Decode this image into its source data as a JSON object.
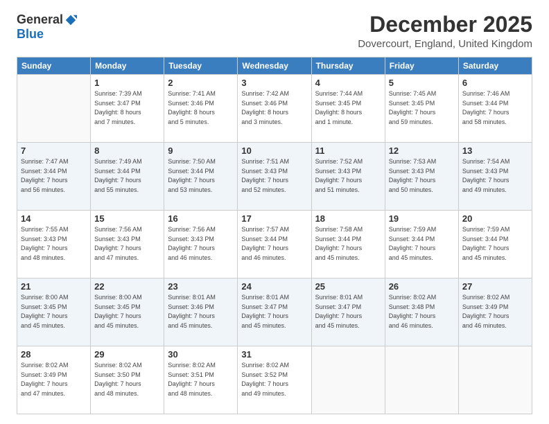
{
  "logo": {
    "general": "General",
    "blue": "Blue"
  },
  "header": {
    "title": "December 2025",
    "subtitle": "Dovercourt, England, United Kingdom"
  },
  "weekdays": [
    "Sunday",
    "Monday",
    "Tuesday",
    "Wednesday",
    "Thursday",
    "Friday",
    "Saturday"
  ],
  "weeks": [
    [
      {
        "day": "",
        "info": ""
      },
      {
        "day": "1",
        "info": "Sunrise: 7:39 AM\nSunset: 3:47 PM\nDaylight: 8 hours\nand 7 minutes."
      },
      {
        "day": "2",
        "info": "Sunrise: 7:41 AM\nSunset: 3:46 PM\nDaylight: 8 hours\nand 5 minutes."
      },
      {
        "day": "3",
        "info": "Sunrise: 7:42 AM\nSunset: 3:46 PM\nDaylight: 8 hours\nand 3 minutes."
      },
      {
        "day": "4",
        "info": "Sunrise: 7:44 AM\nSunset: 3:45 PM\nDaylight: 8 hours\nand 1 minute."
      },
      {
        "day": "5",
        "info": "Sunrise: 7:45 AM\nSunset: 3:45 PM\nDaylight: 7 hours\nand 59 minutes."
      },
      {
        "day": "6",
        "info": "Sunrise: 7:46 AM\nSunset: 3:44 PM\nDaylight: 7 hours\nand 58 minutes."
      }
    ],
    [
      {
        "day": "7",
        "info": "Sunrise: 7:47 AM\nSunset: 3:44 PM\nDaylight: 7 hours\nand 56 minutes."
      },
      {
        "day": "8",
        "info": "Sunrise: 7:49 AM\nSunset: 3:44 PM\nDaylight: 7 hours\nand 55 minutes."
      },
      {
        "day": "9",
        "info": "Sunrise: 7:50 AM\nSunset: 3:44 PM\nDaylight: 7 hours\nand 53 minutes."
      },
      {
        "day": "10",
        "info": "Sunrise: 7:51 AM\nSunset: 3:43 PM\nDaylight: 7 hours\nand 52 minutes."
      },
      {
        "day": "11",
        "info": "Sunrise: 7:52 AM\nSunset: 3:43 PM\nDaylight: 7 hours\nand 51 minutes."
      },
      {
        "day": "12",
        "info": "Sunrise: 7:53 AM\nSunset: 3:43 PM\nDaylight: 7 hours\nand 50 minutes."
      },
      {
        "day": "13",
        "info": "Sunrise: 7:54 AM\nSunset: 3:43 PM\nDaylight: 7 hours\nand 49 minutes."
      }
    ],
    [
      {
        "day": "14",
        "info": "Sunrise: 7:55 AM\nSunset: 3:43 PM\nDaylight: 7 hours\nand 48 minutes."
      },
      {
        "day": "15",
        "info": "Sunrise: 7:56 AM\nSunset: 3:43 PM\nDaylight: 7 hours\nand 47 minutes."
      },
      {
        "day": "16",
        "info": "Sunrise: 7:56 AM\nSunset: 3:43 PM\nDaylight: 7 hours\nand 46 minutes."
      },
      {
        "day": "17",
        "info": "Sunrise: 7:57 AM\nSunset: 3:44 PM\nDaylight: 7 hours\nand 46 minutes."
      },
      {
        "day": "18",
        "info": "Sunrise: 7:58 AM\nSunset: 3:44 PM\nDaylight: 7 hours\nand 45 minutes."
      },
      {
        "day": "19",
        "info": "Sunrise: 7:59 AM\nSunset: 3:44 PM\nDaylight: 7 hours\nand 45 minutes."
      },
      {
        "day": "20",
        "info": "Sunrise: 7:59 AM\nSunset: 3:44 PM\nDaylight: 7 hours\nand 45 minutes."
      }
    ],
    [
      {
        "day": "21",
        "info": "Sunrise: 8:00 AM\nSunset: 3:45 PM\nDaylight: 7 hours\nand 45 minutes."
      },
      {
        "day": "22",
        "info": "Sunrise: 8:00 AM\nSunset: 3:45 PM\nDaylight: 7 hours\nand 45 minutes."
      },
      {
        "day": "23",
        "info": "Sunrise: 8:01 AM\nSunset: 3:46 PM\nDaylight: 7 hours\nand 45 minutes."
      },
      {
        "day": "24",
        "info": "Sunrise: 8:01 AM\nSunset: 3:47 PM\nDaylight: 7 hours\nand 45 minutes."
      },
      {
        "day": "25",
        "info": "Sunrise: 8:01 AM\nSunset: 3:47 PM\nDaylight: 7 hours\nand 45 minutes."
      },
      {
        "day": "26",
        "info": "Sunrise: 8:02 AM\nSunset: 3:48 PM\nDaylight: 7 hours\nand 46 minutes."
      },
      {
        "day": "27",
        "info": "Sunrise: 8:02 AM\nSunset: 3:49 PM\nDaylight: 7 hours\nand 46 minutes."
      }
    ],
    [
      {
        "day": "28",
        "info": "Sunrise: 8:02 AM\nSunset: 3:49 PM\nDaylight: 7 hours\nand 47 minutes."
      },
      {
        "day": "29",
        "info": "Sunrise: 8:02 AM\nSunset: 3:50 PM\nDaylight: 7 hours\nand 48 minutes."
      },
      {
        "day": "30",
        "info": "Sunrise: 8:02 AM\nSunset: 3:51 PM\nDaylight: 7 hours\nand 48 minutes."
      },
      {
        "day": "31",
        "info": "Sunrise: 8:02 AM\nSunset: 3:52 PM\nDaylight: 7 hours\nand 49 minutes."
      },
      {
        "day": "",
        "info": ""
      },
      {
        "day": "",
        "info": ""
      },
      {
        "day": "",
        "info": ""
      }
    ]
  ]
}
